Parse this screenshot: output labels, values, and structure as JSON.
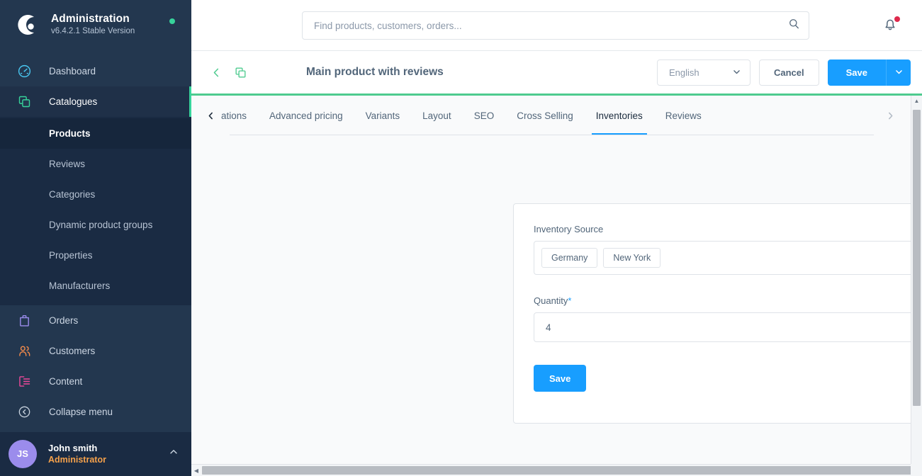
{
  "sidebar": {
    "brand": {
      "title": "Administration",
      "version": "v6.4.2.1 Stable Version",
      "logo_icon": "shopware-logo-icon",
      "status_icon": "status-dot-online"
    },
    "items": [
      {
        "label": "Dashboard",
        "icon": "dashboard-gauge-icon",
        "icon_color": "#49c8f2",
        "active": false
      },
      {
        "label": "Catalogues",
        "icon": "catalogues-copy-icon",
        "icon_color": "#37d39b",
        "active": true
      }
    ],
    "sub_items": [
      {
        "label": "Products",
        "selected": true
      },
      {
        "label": "Reviews",
        "selected": false
      },
      {
        "label": "Categories",
        "selected": false
      },
      {
        "label": "Dynamic product groups",
        "selected": false
      },
      {
        "label": "Properties",
        "selected": false
      },
      {
        "label": "Manufacturers",
        "selected": false
      }
    ],
    "lower_items": [
      {
        "label": "Orders",
        "icon": "orders-bag-icon",
        "icon_color": "#9b8cec"
      },
      {
        "label": "Customers",
        "icon": "customers-people-icon",
        "icon_color": "#f58b4b"
      },
      {
        "label": "Content",
        "icon": "content-list-icon",
        "icon_color": "#ec4899"
      },
      {
        "label": "Collapse menu",
        "icon": "collapse-chevron-circle-icon",
        "icon_color": "#c8d2de"
      }
    ],
    "profile": {
      "initials": "JS",
      "name": "John smith",
      "role": "Administrator",
      "caret_icon": "chevron-up-icon"
    }
  },
  "topbar": {
    "search": {
      "placeholder": "Find products, customers, orders...",
      "value": "",
      "icon": "search-icon"
    },
    "notifications": {
      "icon": "bell-icon",
      "has_unread": true,
      "dot_color": "#de294c"
    }
  },
  "pagehead": {
    "back_icon": "chevron-left-icon",
    "duplicate_icon": "duplicate-icon",
    "title": "Main product with reviews",
    "language": {
      "value": "English",
      "caret_icon": "chevron-down-icon"
    },
    "cancel_label": "Cancel",
    "save_label": "Save",
    "save_caret_icon": "chevron-down-icon",
    "accent_color": "#4ecb8f"
  },
  "tabs": {
    "prev_icon": "chevron-left-icon",
    "next_icon": "chevron-right-icon",
    "items": [
      {
        "label": "ations",
        "active": false,
        "clipped": true
      },
      {
        "label": "Advanced pricing",
        "active": false
      },
      {
        "label": "Variants",
        "active": false
      },
      {
        "label": "Layout",
        "active": false
      },
      {
        "label": "SEO",
        "active": false
      },
      {
        "label": "Cross Selling",
        "active": false
      },
      {
        "label": "Inventories",
        "active": true
      },
      {
        "label": "Reviews",
        "active": false
      }
    ]
  },
  "card": {
    "inventory_source": {
      "label": "Inventory Source",
      "chips": [
        "Germany",
        "New York"
      ],
      "caret_icon": "chevron-down-icon"
    },
    "quantity": {
      "label": "Quantity",
      "required_marker": "*",
      "value": "4",
      "placeholder": ""
    },
    "save_label": "Save"
  },
  "scrollbars": {
    "vertical": {
      "up_icon": "triangle-up-icon",
      "down_icon": "triangle-down-icon"
    },
    "horizontal": {
      "left_icon": "triangle-left-icon",
      "right_icon": "triangle-right-icon"
    }
  }
}
